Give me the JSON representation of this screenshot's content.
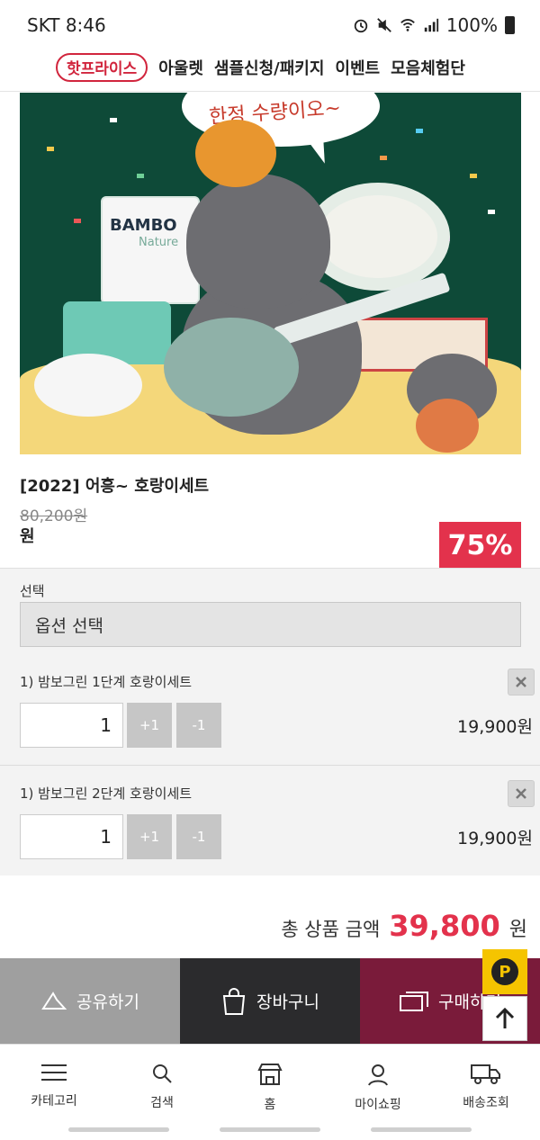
{
  "status": {
    "carrier_time": "SKT 8:46",
    "battery": "100%"
  },
  "topnav": {
    "hot_price": "핫프라이스",
    "items": [
      "아울렛",
      "샘플신청/패키지",
      "이벤트",
      "모음체험단"
    ]
  },
  "hero": {
    "bubble_text": "한정 수량이오~",
    "brand": "BAMBO",
    "brand_sub": "Nature"
  },
  "product": {
    "title": "[2022] 어흥~ 호랑이세트",
    "original_price": "80,200원",
    "sale_price": "원",
    "discount": "75%"
  },
  "options": {
    "label": "선택",
    "select_placeholder": "옵션 선택",
    "items": [
      {
        "name": "1) 밤보그린 1단계 호랑이세트",
        "qty": "1",
        "plus": "+1",
        "minus": "-1",
        "price": "19,900원"
      },
      {
        "name": "1) 밤보그린 2단계 호랑이세트",
        "qty": "1",
        "plus": "+1",
        "minus": "-1",
        "price": "19,900원"
      }
    ]
  },
  "total": {
    "label": "총 상품 금액",
    "amount": "39,800",
    "unit": "원"
  },
  "actions": {
    "share": "공유하기",
    "cart": "장바구니",
    "buy": "구매하기"
  },
  "fab": {
    "point": "P"
  },
  "tabbar": {
    "items": [
      "카테고리",
      "검색",
      "홈",
      "마이쇼핑",
      "배송조회"
    ]
  },
  "colors": {
    "accent": "#e3324c",
    "hot": "#d1253d",
    "buy": "#7a1b3a",
    "cart": "#2b2b2d",
    "share": "#9f9f9f",
    "hero_bg": "#0e4a38"
  }
}
